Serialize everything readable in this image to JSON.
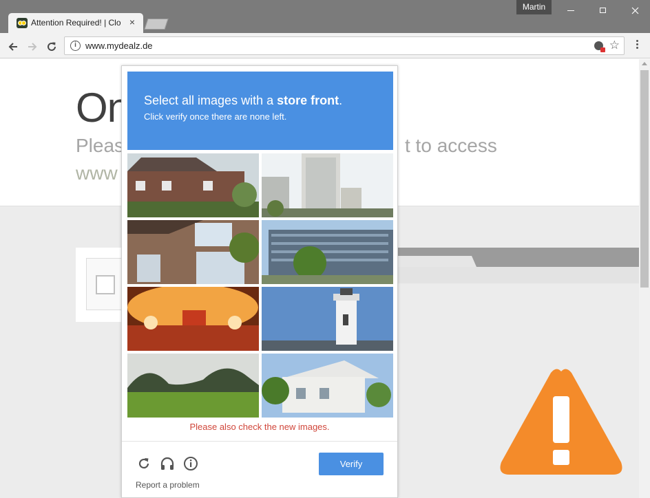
{
  "browser": {
    "tab_title": "Attention Required! | Clo",
    "tab_close": "×",
    "profile_name": "Martin",
    "url": "www.mydealz.de",
    "window_controls": [
      "minimize",
      "maximize",
      "close"
    ],
    "icons": [
      "back-arrow-icon",
      "forward-arrow-icon",
      "reload-icon",
      "info-icon",
      "blocked-extension-icon",
      "star-icon",
      "menu-dots-icon"
    ]
  },
  "page": {
    "heading_fragment": "On",
    "line1_left": "Pleas",
    "line1_right": "t to access",
    "line2_left": "www"
  },
  "captcha": {
    "prompt_prefix": "Select all images with a ",
    "prompt_target": "store front",
    "prompt_suffix": ".",
    "prompt_sub": "Click verify once there are none left.",
    "tiles": [
      {
        "name": "tile-brick-house"
      },
      {
        "name": "tile-city-tower"
      },
      {
        "name": "tile-brick-window-house"
      },
      {
        "name": "tile-office-building"
      },
      {
        "name": "tile-banquet-hall"
      },
      {
        "name": "tile-lighthouse"
      },
      {
        "name": "tile-green-field-hills"
      },
      {
        "name": "tile-white-house"
      }
    ],
    "error_text": "Please also check the new images.",
    "report_link": "Report a problem",
    "verify_label": "Verify"
  },
  "colors": {
    "captcha_blue": "#4a90e2",
    "error_red": "#d0463a",
    "warning_orange": "#f48b2a"
  }
}
